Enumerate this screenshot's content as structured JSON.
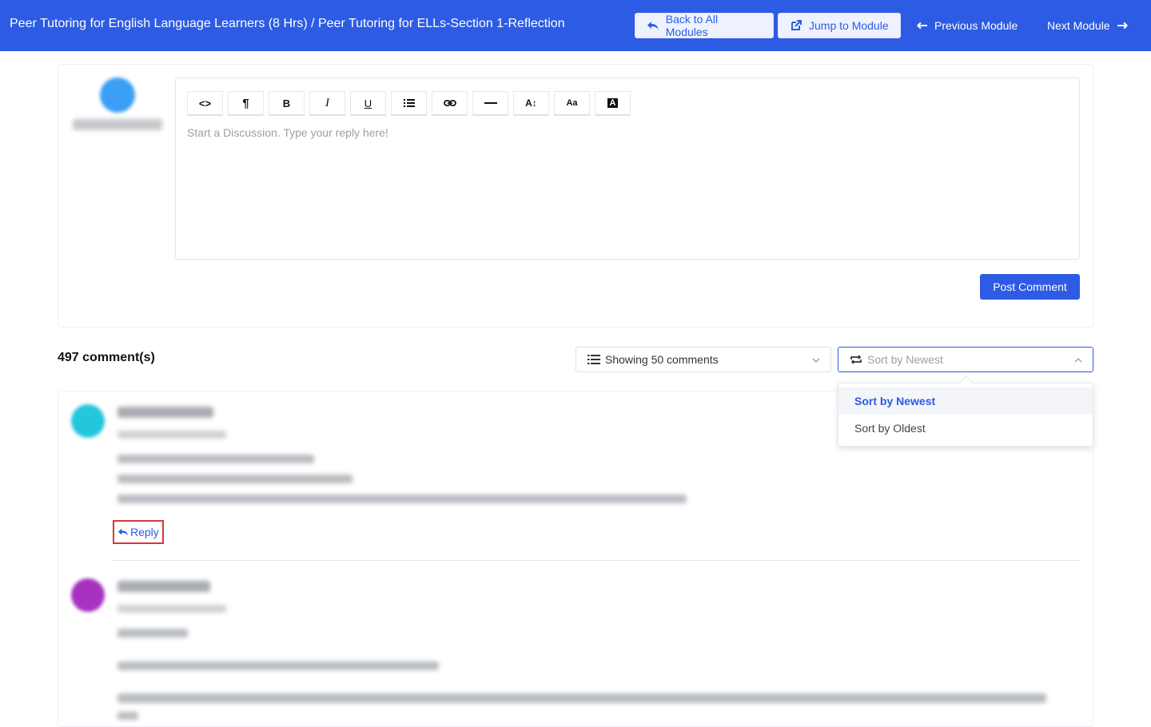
{
  "header": {
    "breadcrumb": "Peer Tutoring for English Language Learners (8 Hrs) / Peer Tutoring for ELLs-Section 1-Reflection",
    "back_label": "Back to All Modules",
    "jump_label": "Jump to Module",
    "prev_label": "Previous Module",
    "next_label": "Next Module",
    "accent": "#2d5be3"
  },
  "editor": {
    "toolbar": [
      {
        "name": "code-view-button",
        "icon": "code-icon",
        "glyph": "<>"
      },
      {
        "name": "paragraph-button",
        "icon": "pilcrow-icon",
        "glyph": "¶"
      },
      {
        "name": "bold-button",
        "icon": "bold-icon",
        "glyph": "B"
      },
      {
        "name": "italic-button",
        "icon": "italic-icon",
        "glyph": "I"
      },
      {
        "name": "underline-button",
        "icon": "underline-icon",
        "glyph": "U"
      },
      {
        "name": "list-button",
        "icon": "list-icon",
        "glyph": ""
      },
      {
        "name": "link-button",
        "icon": "link-icon",
        "glyph": ""
      },
      {
        "name": "horizontal-rule-button",
        "icon": "horizontal-rule-icon",
        "glyph": ""
      },
      {
        "name": "font-size-button",
        "icon": "font-size-icon",
        "glyph": "A↕"
      },
      {
        "name": "font-family-button",
        "icon": "font-family-icon",
        "glyph": "Aa"
      },
      {
        "name": "text-color-button",
        "icon": "text-color-icon",
        "glyph": "A"
      }
    ],
    "placeholder": "Start a Discussion. Type your reply here!",
    "post_label": "Post Comment"
  },
  "comments": {
    "count_label": "497 comment(s)",
    "showing_label": "Showing 50 comments",
    "sort_placeholder": "Sort by Newest",
    "sort_options": [
      "Sort by Newest",
      "Sort by Oldest"
    ],
    "selected_sort": "Sort by Newest",
    "reply_label": "Reply"
  }
}
